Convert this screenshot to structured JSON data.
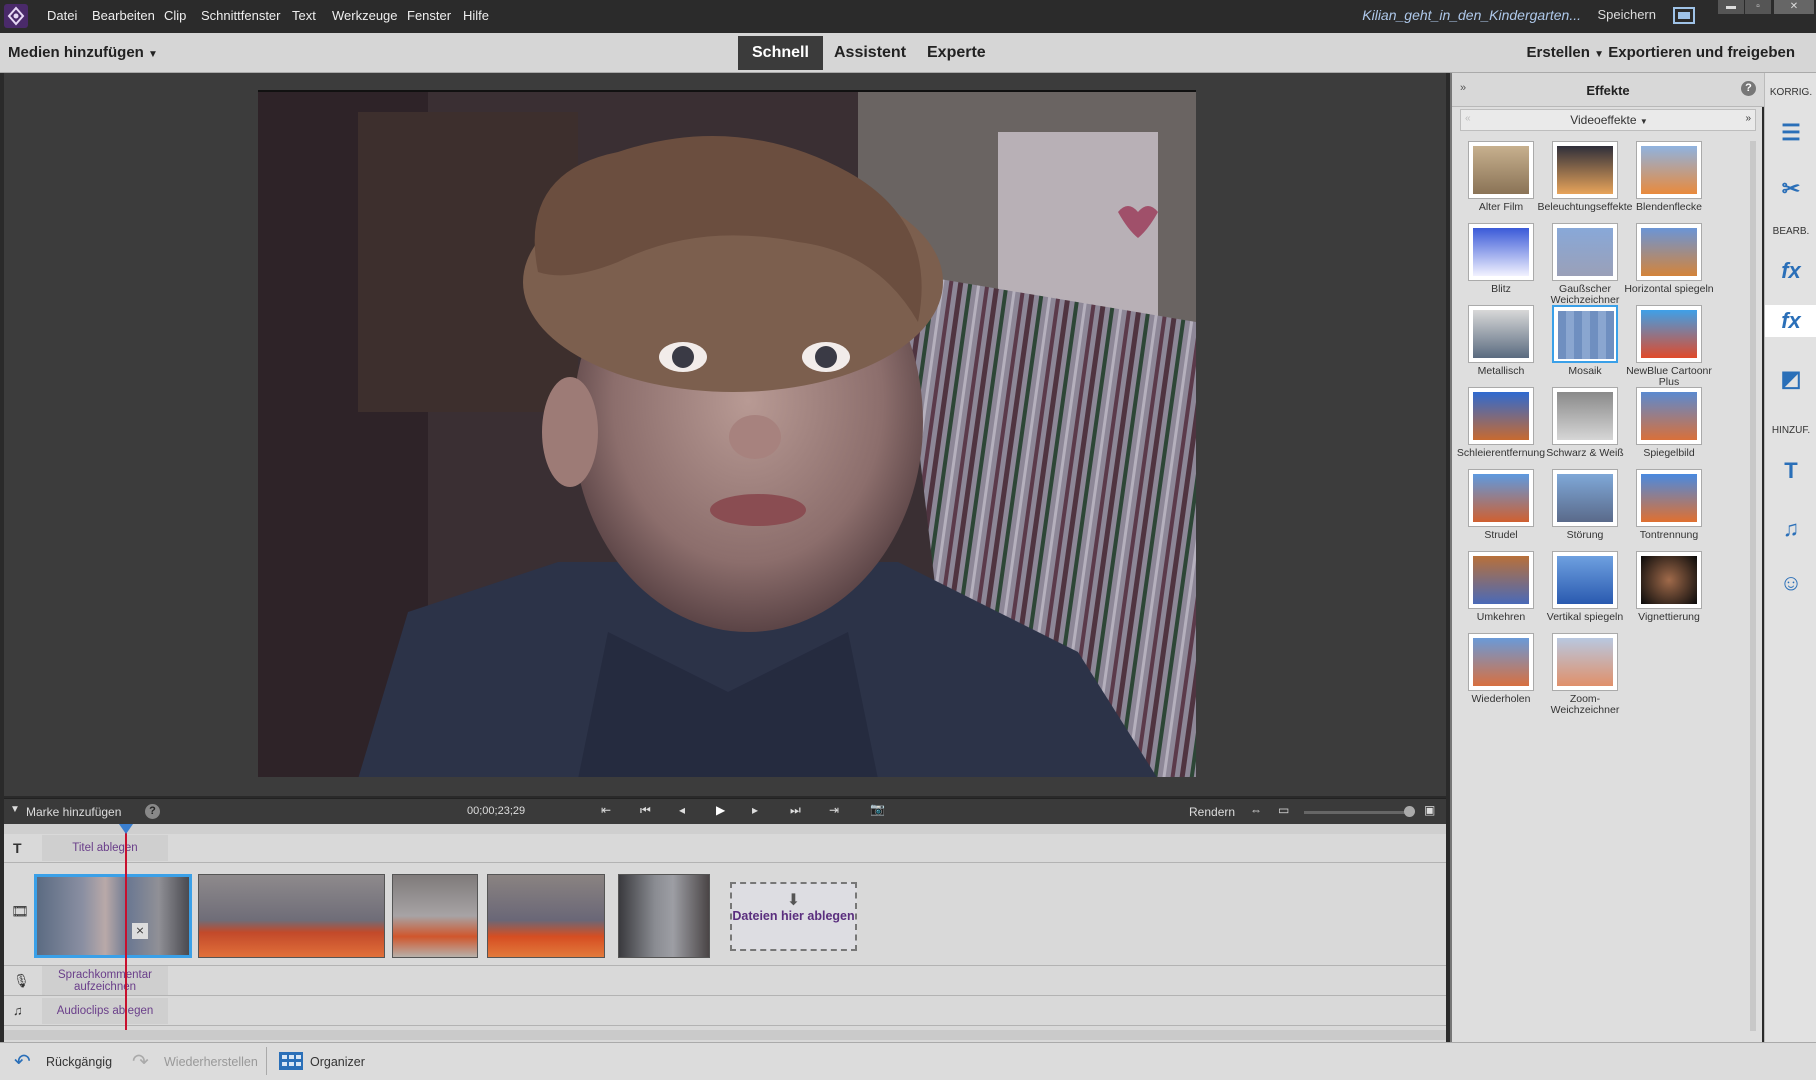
{
  "menubar": {
    "items": [
      "Datei",
      "Bearbeiten",
      "Clip",
      "Schnittfenster",
      "Text",
      "Werkzeuge",
      "Fenster",
      "Hilfe"
    ],
    "filename": "Kilian_geht_in_den_Kindergarten...",
    "save_label": "Speichern"
  },
  "modebar": {
    "media_add": "Medien hinzufügen",
    "tabs": [
      "Schnell",
      "Assistent",
      "Experte"
    ],
    "create": "Erstellen",
    "export": "Exportieren und freigeben"
  },
  "transport": {
    "marker": "Marke hinzufügen",
    "timecode": "00;00;23;29",
    "render": "Rendern"
  },
  "timeline": {
    "title_track": "Titel ablegen",
    "drop_files": "Dateien hier ablegen",
    "voice_track": "Sprachkommentar aufzeichnen",
    "audio_track": "Audioclips ablegen"
  },
  "bottombar": {
    "undo": "Rückgängig",
    "redo": "Wiederherstellen",
    "organizer": "Organizer"
  },
  "effects": {
    "title": "Effekte",
    "category": "Videoeffekte",
    "items": [
      "Alter Film",
      "Beleuchtungseffekte",
      "Blendenflecke",
      "Blitz",
      "Gaußscher Weichzeichner",
      "Horizontal spiegeln",
      "Metallisch",
      "Mosaik",
      "NewBlue Cartoonr Plus",
      "Schleierentfernung",
      "Schwarz & Weiß",
      "Spiegelbild",
      "Strudel",
      "Störung",
      "Tontrennung",
      "Umkehren",
      "Vertikal spiegeln",
      "Vignettierung",
      "Wiederholen",
      "Zoom-Weichzeichner"
    ],
    "selected": "Mosaik"
  },
  "rightbar": {
    "korrig": "KORRIG.",
    "bearb": "BEARB.",
    "hinzuf": "HINZUF."
  },
  "colors": {
    "accent": "#2a6fb8",
    "playhead": "#c8102e",
    "selection": "#3aa0e8"
  }
}
